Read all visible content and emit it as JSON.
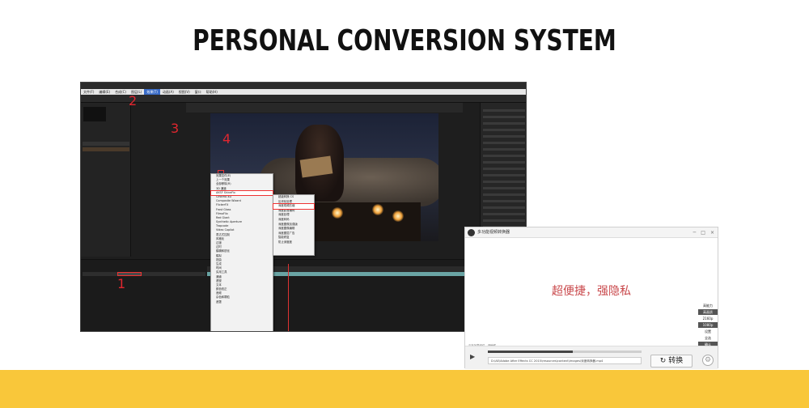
{
  "slide": {
    "title": "PERSONAL CONVERSION SYSTEM",
    "accent_color": "#f9c73a",
    "annotation_color": "#e0262f"
  },
  "ae": {
    "menubar": [
      "文件(F)",
      "编辑(E)",
      "合成(C)",
      "图层(L)",
      "效果(T)",
      "动画(A)",
      "视图(V)",
      "窗口",
      "帮助(H)"
    ],
    "active_menu_index": 4,
    "effects_menu": [
      "效果控件(E)",
      "上一个效果",
      "全部移除(R)",
      "3D 通道",
      "AKSF ShineFix",
      "CINEMA 4D",
      "Composite Wizard",
      "FlickerFX",
      "Frost Glass",
      "FilmoFlix",
      "Red Giant",
      "Synthetic Aperture",
      "Trapcode",
      "Video Copilot",
      "表达式控制",
      "风格化",
      "过渡",
      "过时",
      "模糊和锐化",
      "模拟",
      "扭曲",
      "生成",
      "时间",
      "实用工具",
      "通道",
      "透视",
      "文本",
      "颜色校正",
      "音频",
      "杂色和颗粒",
      "遮罩"
    ],
    "effects_menu_highlight_index": 4,
    "submenu": [
      "超级转换 CS",
      "区块化处理",
      "深度视频压缩",
      "深度影音编码",
      "深度处理",
      "深度转码",
      "深度图像加强版",
      "深度图像编辑",
      "深度图层广告",
      "智能修复",
      "防止深度度"
    ],
    "submenu_highlight_index": 2,
    "steps": [
      "1",
      "2",
      "3",
      "4"
    ]
  },
  "converter": {
    "title": "多功能视频转换器",
    "window_controls": [
      "─",
      "□",
      "×"
    ],
    "slogan": "超便捷，强隐私",
    "side_options": [
      "高能力",
      "高画质",
      "2160p",
      "1080p",
      "设置",
      "全选",
      "确认"
    ],
    "side_options_dark": [
      1,
      3,
      6
    ],
    "play_icon": "play-icon",
    "progress": 0.55,
    "file_path": "D:\\AE\\Adobe After Effects CC 2015\\resources\\content\\images\\深度转换器.mp4",
    "convert_button": "转换",
    "convert_icon": "refresh-icon",
    "status_text": "正在加载组件，请稍候"
  }
}
